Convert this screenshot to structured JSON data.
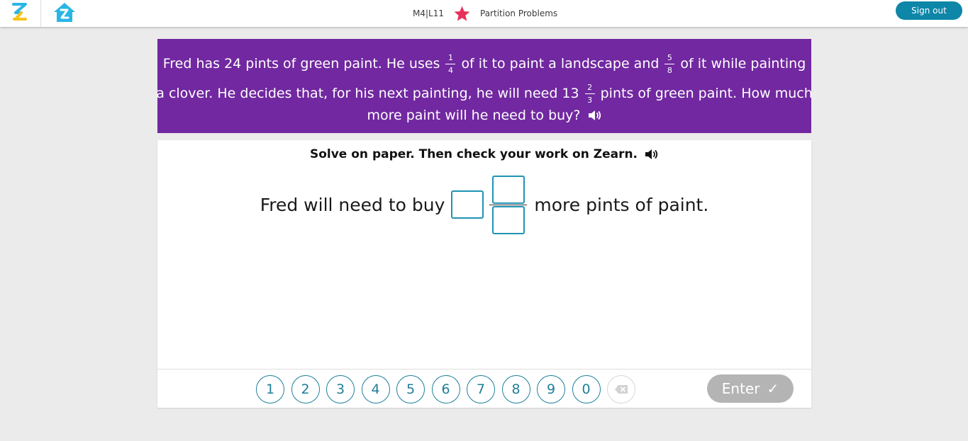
{
  "header": {
    "lesson_code": "M4|L11",
    "lesson_title": "Partition Problems",
    "sign_out_label": "Sign out"
  },
  "problem": {
    "line1_a": "Fred has 24 pints of green paint. He uses",
    "frac1_num": "1",
    "frac1_den": "4",
    "line1_b": "of it to paint a landscape and",
    "frac2_num": "5",
    "frac2_den": "8",
    "line1_c": "of it while painting",
    "line2_a": "a clover. He decides that, for his next painting, he will need 13",
    "frac3_num": "2",
    "frac3_den": "3",
    "line2_b": "pints of green paint. How much",
    "line3": "more paint will he need to buy?"
  },
  "work": {
    "instruction": "Solve on paper. Then check your work on Zearn.",
    "sentence_before": "Fred will need to buy",
    "sentence_after": "more pints of paint."
  },
  "keypad": {
    "digits": [
      "1",
      "2",
      "3",
      "4",
      "5",
      "6",
      "7",
      "8",
      "9",
      "0"
    ],
    "enter_label": "Enter",
    "enter_check": "✓"
  },
  "colors": {
    "banner": "#7128a0",
    "accent": "#1f93b3",
    "sign_out": "#0d86a8",
    "star": "#e8305b",
    "logo_blue": "#29b6e6",
    "logo_yellow": "#f7c21b",
    "enter_disabled": "#b4b4b4"
  },
  "icons": [
    "zearn-logo-icon",
    "home-icon",
    "star-icon",
    "speaker-icon",
    "backspace-icon",
    "checkmark-icon"
  ]
}
